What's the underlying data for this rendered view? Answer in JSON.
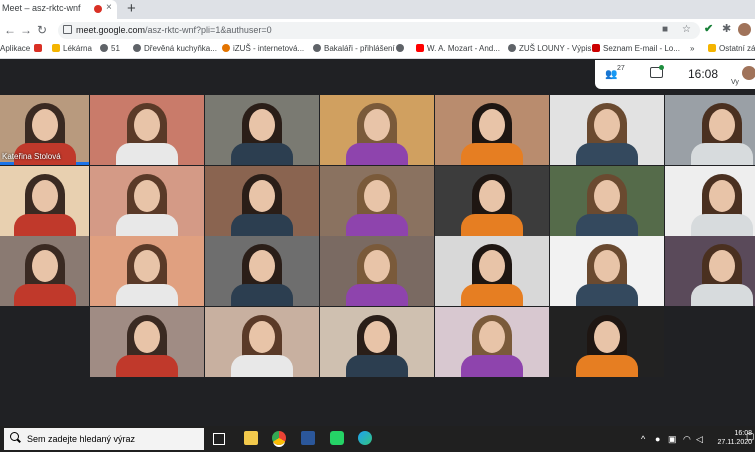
{
  "browser": {
    "tab_title": "Meet – asz-rktc-wnf",
    "tab_close": "×",
    "new_tab": "+",
    "url_host": "meet.google.com",
    "url_path": "/asz-rktc-wnf?pli=1&authuser=0",
    "bookmarks": [
      {
        "label": "Aplikace",
        "color": "#4285f4"
      },
      {
        "label": "Lékárna",
        "color": "#f4b400"
      },
      {
        "label": "51",
        "color": "#5f6368"
      },
      {
        "label": "Dřevěná kuchyňka...",
        "color": "#5f6368"
      },
      {
        "label": "iZUŠ - internetová...",
        "color": "#e37400"
      },
      {
        "label": "Bakaláři - přihlášení",
        "color": "#5f6368"
      },
      {
        "label": "",
        "color": "#5f6368"
      },
      {
        "label": "W. A. Mozart - And...",
        "color": "#ff0000"
      },
      {
        "label": "ZUŠ LOUNY - Výpis",
        "color": "#5f6368"
      },
      {
        "label": "Seznam E-mail - Lo...",
        "color": "#cc0000"
      },
      {
        "label": "»",
        "color": ""
      },
      {
        "label": "Ostatní zá",
        "color": "#f4b400"
      }
    ]
  },
  "meet": {
    "participant_count": "27",
    "clock": "16:08",
    "self_label": "Vy",
    "pinned_name": "Kateřina Stolová"
  },
  "taskbar": {
    "search_placeholder": "Sem zadejte hledaný výraz",
    "time": "16:08",
    "date": "27.11.2020"
  }
}
